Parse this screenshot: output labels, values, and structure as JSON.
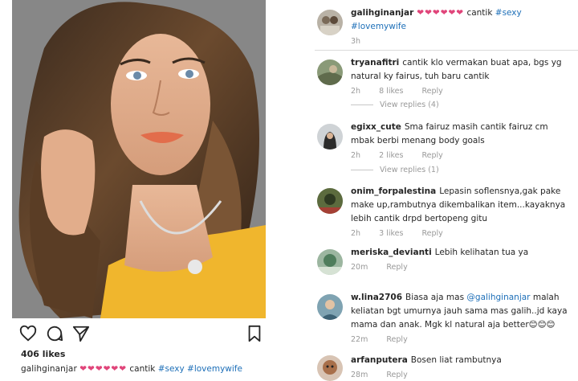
{
  "post": {
    "likes": "406 likes",
    "caption": {
      "username": "galihginanjar",
      "hearts": "❤❤❤❤❤❤",
      "text": "cantik",
      "tag1": "#sexy",
      "tag2": "#lovemywife"
    }
  },
  "header_comment": {
    "username": "galihginanjar",
    "hearts": "❤❤❤❤❤❤",
    "text": "cantik",
    "tag1": "#sexy",
    "tag2": "#lovemywife",
    "time": "3h"
  },
  "comments": [
    {
      "username": "tryanafitri",
      "text": "cantik klo vermakan buat apa, bgs yg natural ky fairus, tuh baru cantik",
      "time": "2h",
      "likes": "8 likes",
      "reply": "Reply",
      "view_replies": "View replies (4)"
    },
    {
      "username": "egixx_cute",
      "text": "Sma fairuz masih cantik fairuz cm mbak berbi menang body goals",
      "time": "2h",
      "likes": "2 likes",
      "reply": "Reply",
      "view_replies": "View replies (1)"
    },
    {
      "username": "onim_forpalestina",
      "text": "Lepasin soflensnya,gak pake make up,rambutnya dikembalikan item...kayaknya lebih cantik drpd bertopeng gitu",
      "time": "2h",
      "likes": "3 likes",
      "reply": "Reply"
    },
    {
      "username": "meriska_devianti",
      "text": "Lebih kelihatan tua ya",
      "time": "20m",
      "reply": "Reply"
    },
    {
      "username": "w.lina2706",
      "text_before": "Biasa aja mas",
      "mention": "@galihginanjar",
      "text_after": "malah keliatan bgt umurnya jauh sama mas galih..jd kaya mama dan anak. Mgk kl natural aja better😊😊😊",
      "time": "22m",
      "reply": "Reply"
    },
    {
      "username": "arfanputera",
      "text": "Bosen liat rambutnya",
      "time": "28m",
      "reply": "Reply"
    }
  ],
  "colors": {
    "accent": "#1d6fb8",
    "heart": "#e0457a",
    "muted": "#999999"
  },
  "icons": [
    "heart-icon",
    "comment-icon",
    "share-icon",
    "bookmark-icon"
  ]
}
